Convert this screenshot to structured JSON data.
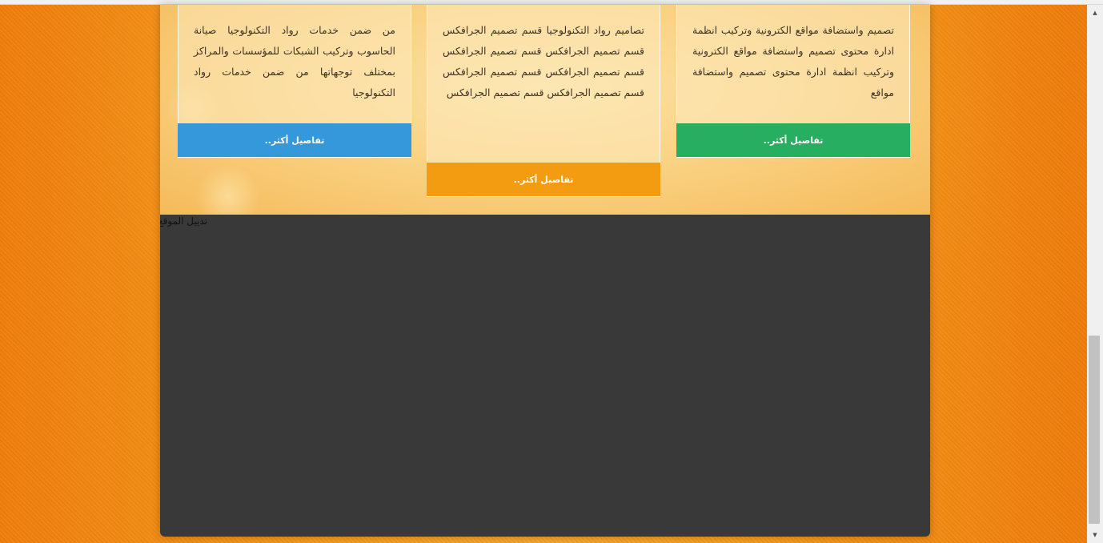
{
  "services": [
    {
      "text": "تصميم واستضافة مواقع الكترونية وتركيب انظمة ادارة محتوى تصميم واستضافة مواقع الكترونية وتركيب انظمة ادارة محتوى تصميم واستضافة مواقع",
      "button_label": "تفاصيل أكثر..",
      "button_color": "#27ae60"
    },
    {
      "text": "تصاميم رواد التكنولوجيا قسم تصميم الجرافكس قسم تصميم الجرافكس قسم تصميم الجرافكس قسم تصميم الجرافكس قسم تصميم الجرافكس قسم تصميم الجرافكس قسم تصميم الجرافكس",
      "button_label": "تفاصيل أكثر..",
      "button_color": "#f39c12"
    },
    {
      "text": "من ضمن خدمات رواد التكنولوجيا صيانة الحاسوب وتركيب الشبكات للمؤسسات والمراكز بمختلف توجهاتها من ضمن خدمات رواد التكنولوجيا",
      "button_label": "تفاصيل أكثر..",
      "button_color": "#3498db"
    }
  ],
  "footer": {
    "label": "تذييل الموقع",
    "background": "#393939"
  },
  "scrollbar": {
    "up_icon": "scroll-up-arrow-icon",
    "down_icon": "scroll-down-arrow-icon"
  }
}
